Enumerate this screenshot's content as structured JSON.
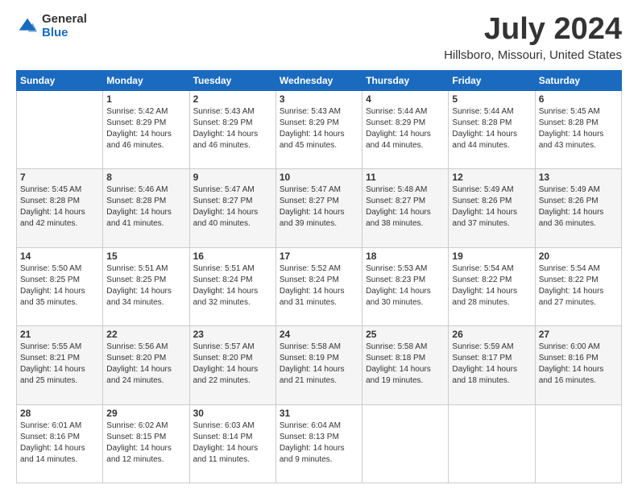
{
  "header": {
    "logo_general": "General",
    "logo_blue": "Blue",
    "main_title": "July 2024",
    "subtitle": "Hillsboro, Missouri, United States"
  },
  "calendar": {
    "weekdays": [
      "Sunday",
      "Monday",
      "Tuesday",
      "Wednesday",
      "Thursday",
      "Friday",
      "Saturday"
    ],
    "weeks": [
      [
        {
          "day": "",
          "info": ""
        },
        {
          "day": "1",
          "info": "Sunrise: 5:42 AM\nSunset: 8:29 PM\nDaylight: 14 hours\nand 46 minutes."
        },
        {
          "day": "2",
          "info": "Sunrise: 5:43 AM\nSunset: 8:29 PM\nDaylight: 14 hours\nand 46 minutes."
        },
        {
          "day": "3",
          "info": "Sunrise: 5:43 AM\nSunset: 8:29 PM\nDaylight: 14 hours\nand 45 minutes."
        },
        {
          "day": "4",
          "info": "Sunrise: 5:44 AM\nSunset: 8:29 PM\nDaylight: 14 hours\nand 44 minutes."
        },
        {
          "day": "5",
          "info": "Sunrise: 5:44 AM\nSunset: 8:28 PM\nDaylight: 14 hours\nand 44 minutes."
        },
        {
          "day": "6",
          "info": "Sunrise: 5:45 AM\nSunset: 8:28 PM\nDaylight: 14 hours\nand 43 minutes."
        }
      ],
      [
        {
          "day": "7",
          "info": "Sunrise: 5:45 AM\nSunset: 8:28 PM\nDaylight: 14 hours\nand 42 minutes."
        },
        {
          "day": "8",
          "info": "Sunrise: 5:46 AM\nSunset: 8:28 PM\nDaylight: 14 hours\nand 41 minutes."
        },
        {
          "day": "9",
          "info": "Sunrise: 5:47 AM\nSunset: 8:27 PM\nDaylight: 14 hours\nand 40 minutes."
        },
        {
          "day": "10",
          "info": "Sunrise: 5:47 AM\nSunset: 8:27 PM\nDaylight: 14 hours\nand 39 minutes."
        },
        {
          "day": "11",
          "info": "Sunrise: 5:48 AM\nSunset: 8:27 PM\nDaylight: 14 hours\nand 38 minutes."
        },
        {
          "day": "12",
          "info": "Sunrise: 5:49 AM\nSunset: 8:26 PM\nDaylight: 14 hours\nand 37 minutes."
        },
        {
          "day": "13",
          "info": "Sunrise: 5:49 AM\nSunset: 8:26 PM\nDaylight: 14 hours\nand 36 minutes."
        }
      ],
      [
        {
          "day": "14",
          "info": "Sunrise: 5:50 AM\nSunset: 8:25 PM\nDaylight: 14 hours\nand 35 minutes."
        },
        {
          "day": "15",
          "info": "Sunrise: 5:51 AM\nSunset: 8:25 PM\nDaylight: 14 hours\nand 34 minutes."
        },
        {
          "day": "16",
          "info": "Sunrise: 5:51 AM\nSunset: 8:24 PM\nDaylight: 14 hours\nand 32 minutes."
        },
        {
          "day": "17",
          "info": "Sunrise: 5:52 AM\nSunset: 8:24 PM\nDaylight: 14 hours\nand 31 minutes."
        },
        {
          "day": "18",
          "info": "Sunrise: 5:53 AM\nSunset: 8:23 PM\nDaylight: 14 hours\nand 30 minutes."
        },
        {
          "day": "19",
          "info": "Sunrise: 5:54 AM\nSunset: 8:22 PM\nDaylight: 14 hours\nand 28 minutes."
        },
        {
          "day": "20",
          "info": "Sunrise: 5:54 AM\nSunset: 8:22 PM\nDaylight: 14 hours\nand 27 minutes."
        }
      ],
      [
        {
          "day": "21",
          "info": "Sunrise: 5:55 AM\nSunset: 8:21 PM\nDaylight: 14 hours\nand 25 minutes."
        },
        {
          "day": "22",
          "info": "Sunrise: 5:56 AM\nSunset: 8:20 PM\nDaylight: 14 hours\nand 24 minutes."
        },
        {
          "day": "23",
          "info": "Sunrise: 5:57 AM\nSunset: 8:20 PM\nDaylight: 14 hours\nand 22 minutes."
        },
        {
          "day": "24",
          "info": "Sunrise: 5:58 AM\nSunset: 8:19 PM\nDaylight: 14 hours\nand 21 minutes."
        },
        {
          "day": "25",
          "info": "Sunrise: 5:58 AM\nSunset: 8:18 PM\nDaylight: 14 hours\nand 19 minutes."
        },
        {
          "day": "26",
          "info": "Sunrise: 5:59 AM\nSunset: 8:17 PM\nDaylight: 14 hours\nand 18 minutes."
        },
        {
          "day": "27",
          "info": "Sunrise: 6:00 AM\nSunset: 8:16 PM\nDaylight: 14 hours\nand 16 minutes."
        }
      ],
      [
        {
          "day": "28",
          "info": "Sunrise: 6:01 AM\nSunset: 8:16 PM\nDaylight: 14 hours\nand 14 minutes."
        },
        {
          "day": "29",
          "info": "Sunrise: 6:02 AM\nSunset: 8:15 PM\nDaylight: 14 hours\nand 12 minutes."
        },
        {
          "day": "30",
          "info": "Sunrise: 6:03 AM\nSunset: 8:14 PM\nDaylight: 14 hours\nand 11 minutes."
        },
        {
          "day": "31",
          "info": "Sunrise: 6:04 AM\nSunset: 8:13 PM\nDaylight: 14 hours\nand 9 minutes."
        },
        {
          "day": "",
          "info": ""
        },
        {
          "day": "",
          "info": ""
        },
        {
          "day": "",
          "info": ""
        }
      ]
    ]
  }
}
